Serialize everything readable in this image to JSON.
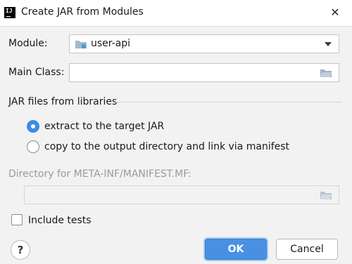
{
  "dialog": {
    "title": "Create JAR from Modules",
    "app_icon_text": "IJ",
    "close_glyph": "✕"
  },
  "module": {
    "label": "Module:",
    "value": "user-api"
  },
  "main_class": {
    "label": "Main Class:",
    "value": ""
  },
  "jar_section": {
    "title": "JAR files from libraries",
    "options": [
      {
        "label": "extract to the target JAR",
        "selected": true
      },
      {
        "label": "copy to the output directory and link via manifest",
        "selected": false
      }
    ]
  },
  "manifest_dir": {
    "label": "Directory for META-INF/MANIFEST.MF:",
    "value": "",
    "enabled": false
  },
  "include_tests": {
    "label": "Include tests",
    "checked": false
  },
  "buttons": {
    "help": "?",
    "ok": "OK",
    "cancel": "Cancel"
  },
  "colors": {
    "accent": "#4a90e2",
    "radio_selected": "#3d8be3",
    "folder_icon": "#8fa4b8",
    "module_icon_badge": "#3d9fe0"
  }
}
